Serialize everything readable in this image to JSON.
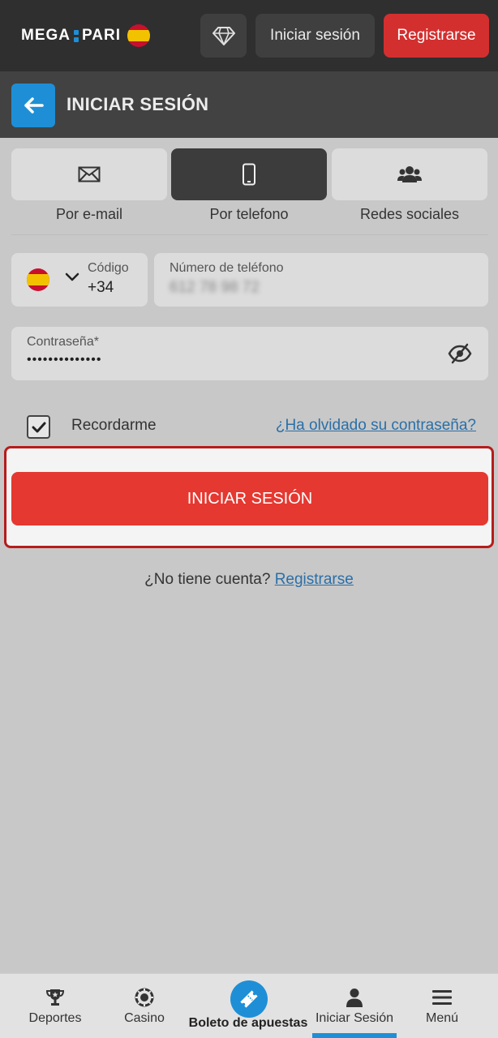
{
  "header": {
    "logo_left": "MEGA",
    "logo_right": "PARI",
    "login_label": "Iniciar sesión",
    "register_label": "Registrarse"
  },
  "titlebar": {
    "title": "INICIAR SESIÓN"
  },
  "tabs": [
    {
      "label": "Por e-mail",
      "icon": "envelope-icon",
      "active": false
    },
    {
      "label": "Por telefono",
      "icon": "phone-icon",
      "active": true
    },
    {
      "label": "Redes sociales",
      "icon": "people-icon",
      "active": false
    }
  ],
  "phone": {
    "code_label": "Código",
    "code_value": "+34",
    "number_label": "Número de teléfono",
    "number_value": "612 78 98 72"
  },
  "password": {
    "label": "Contraseña*",
    "value": "••••••••••••••"
  },
  "remember": {
    "label": "Recordarme",
    "checked": true
  },
  "forgot_label": "¿Ha olvidado su contraseña?",
  "submit_label": "INICIAR SESIÓN",
  "no_account": {
    "text": "¿No tiene cuenta?",
    "link": "Registrarse"
  },
  "bottom_nav": {
    "sports": "Deportes",
    "casino": "Casino",
    "betslip": "Boleto de apuestas",
    "login": "Iniciar Sesión",
    "menu": "Menú"
  },
  "colors": {
    "accent_blue": "#1e8fd6",
    "accent_red": "#e53830",
    "header_bg": "#2f2f2f"
  }
}
